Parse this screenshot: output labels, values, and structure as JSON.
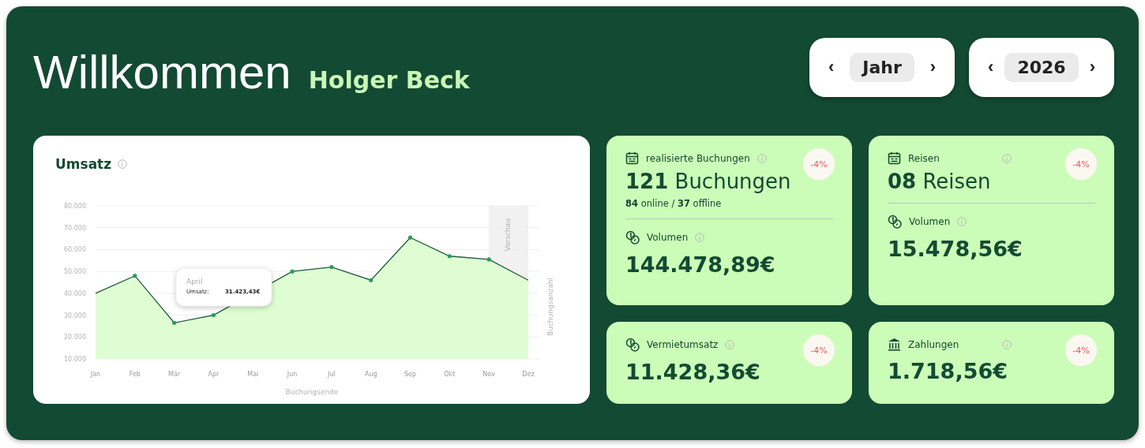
{
  "header": {
    "greeting": "Willkommen",
    "name": "Holger Beck"
  },
  "selectors": [
    {
      "prev": "‹",
      "value": "Jahr",
      "next": "›"
    },
    {
      "prev": "‹",
      "value": "2026",
      "next": "›"
    }
  ],
  "revenue": {
    "title": "Umsatz",
    "tooltip": {
      "month": "April",
      "label": "Umsatz:",
      "value": "31.423,43€"
    },
    "chart_data": {
      "type": "area",
      "xlabel": "Buchungsende",
      "ylabel": "Buchungsanzahl",
      "categories": [
        "Jan",
        "Feb",
        "Mär",
        "Apr",
        "Mai",
        "Jun",
        "Jul",
        "Aug",
        "Sep",
        "Okt",
        "Nov",
        "Dez"
      ],
      "series": [
        {
          "color": "#1e5a3a",
          "values": [
            40000,
            48000,
            26500,
            30000,
            null,
            50000,
            52000,
            46000,
            65500,
            57000,
            55500,
            46000
          ]
        }
      ],
      "ylim": [
        10000,
        80000
      ],
      "grid": true,
      "annotations": [
        {
          "text": "Vorschau"
        }
      ],
      "yticks": [
        {
          "value": 10000,
          "label": "10.000"
        },
        {
          "value": 20000,
          "label": "20.000"
        },
        {
          "value": 30000,
          "label": "30.000"
        },
        {
          "value": 40000,
          "label": "40.000"
        },
        {
          "value": 50000,
          "label": "50.000"
        },
        {
          "value": 60000,
          "label": "60.000"
        },
        {
          "value": 70000,
          "label": "70.000"
        },
        {
          "value": 80000,
          "label": "80.000"
        }
      ]
    }
  },
  "stat_cards": [
    {
      "kind": "split",
      "label": "realisierte Buchungen",
      "count": "121",
      "unit": "Buchungen",
      "breakdown": [
        {
          "count": "84",
          "label": "online /"
        },
        {
          "count": "37",
          "label": "offline"
        }
      ],
      "badge": "-4%",
      "volume": {
        "label": "Volumen",
        "value": "144.478,89€"
      }
    },
    {
      "kind": "split",
      "label": "Reisen",
      "count": "08",
      "unit": "Reisen",
      "badge": "-4%",
      "volume": {
        "label": "Volumen",
        "value": "15.478,56€"
      }
    },
    {
      "kind": "single",
      "label": "Vermietumsatz",
      "value": "11.428,36€",
      "badge": "-4%"
    },
    {
      "kind": "single",
      "label": "Zahlungen",
      "value": "1.718,56€",
      "badge": "-4%"
    }
  ]
}
